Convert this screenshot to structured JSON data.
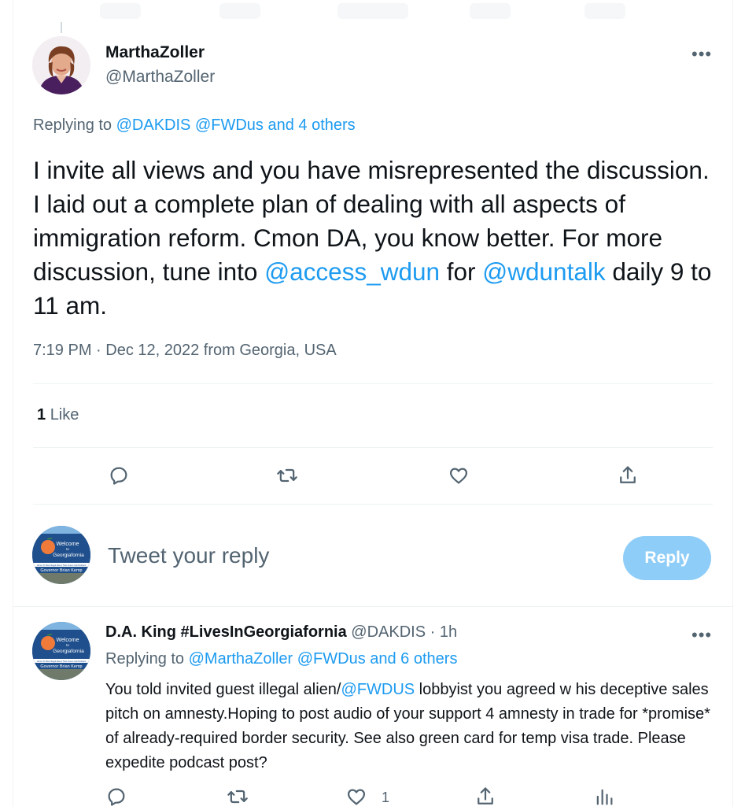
{
  "main_tweet": {
    "author_name": "MarthaZoller",
    "author_handle": "@MarthaZoller",
    "more_label": "•••",
    "replying_prefix": "Replying to",
    "replying_to": "@DAKDIS @FWDus and 4 others",
    "text_parts": {
      "p1": "I invite all views and you have misrepresented the discussion.  I laid out a complete plan of dealing with all aspects of immigration reform. Cmon DA, you know better. For more discussion, tune into ",
      "m1": "@access_wdun",
      "p2": " for ",
      "m2": "@wduntalk",
      "p3": " daily 9 to 11 am."
    },
    "timestamp": "7:19 PM · Dec 12, 2022 from Georgia, USA",
    "like_count": "1",
    "like_label": "Like"
  },
  "compose": {
    "placeholder": "Tweet your reply",
    "button_label": "Reply",
    "avatar_text": {
      "welcome": "Welcome",
      "to": "to",
      "place": "Georgiafornia",
      "small": "Home To More Illegal Aliens Than Green Card Holders",
      "governor": "Governor Brian Kemp"
    }
  },
  "reply_tweet": {
    "author_name": "D.A. King #LivesInGeorgiafornia",
    "author_handle": "@DAKDIS",
    "time": "· 1h",
    "more_label": "•••",
    "replying_prefix": "Replying to",
    "replying_to": "@MarthaZoller @FWDus and 6 others",
    "text_parts": {
      "p1": "You told invited guest illegal alien/",
      "m1": "@FWDUS",
      "p2": " lobbyist you agreed w his deceptive sales pitch on amnesty.Hoping to post audio of your support 4 amnesty in trade for *promise* of already-required border security. See also green card for temp visa trade. Please expedite podcast post?"
    },
    "like_count": "1"
  },
  "colors": {
    "link": "#1d9bf0",
    "secondary_text": "#536471",
    "reply_button_disabled": "#8ecdf8"
  },
  "icons": [
    "reply-icon",
    "retweet-icon",
    "like-icon",
    "share-icon",
    "analytics-icon",
    "more-icon"
  ]
}
